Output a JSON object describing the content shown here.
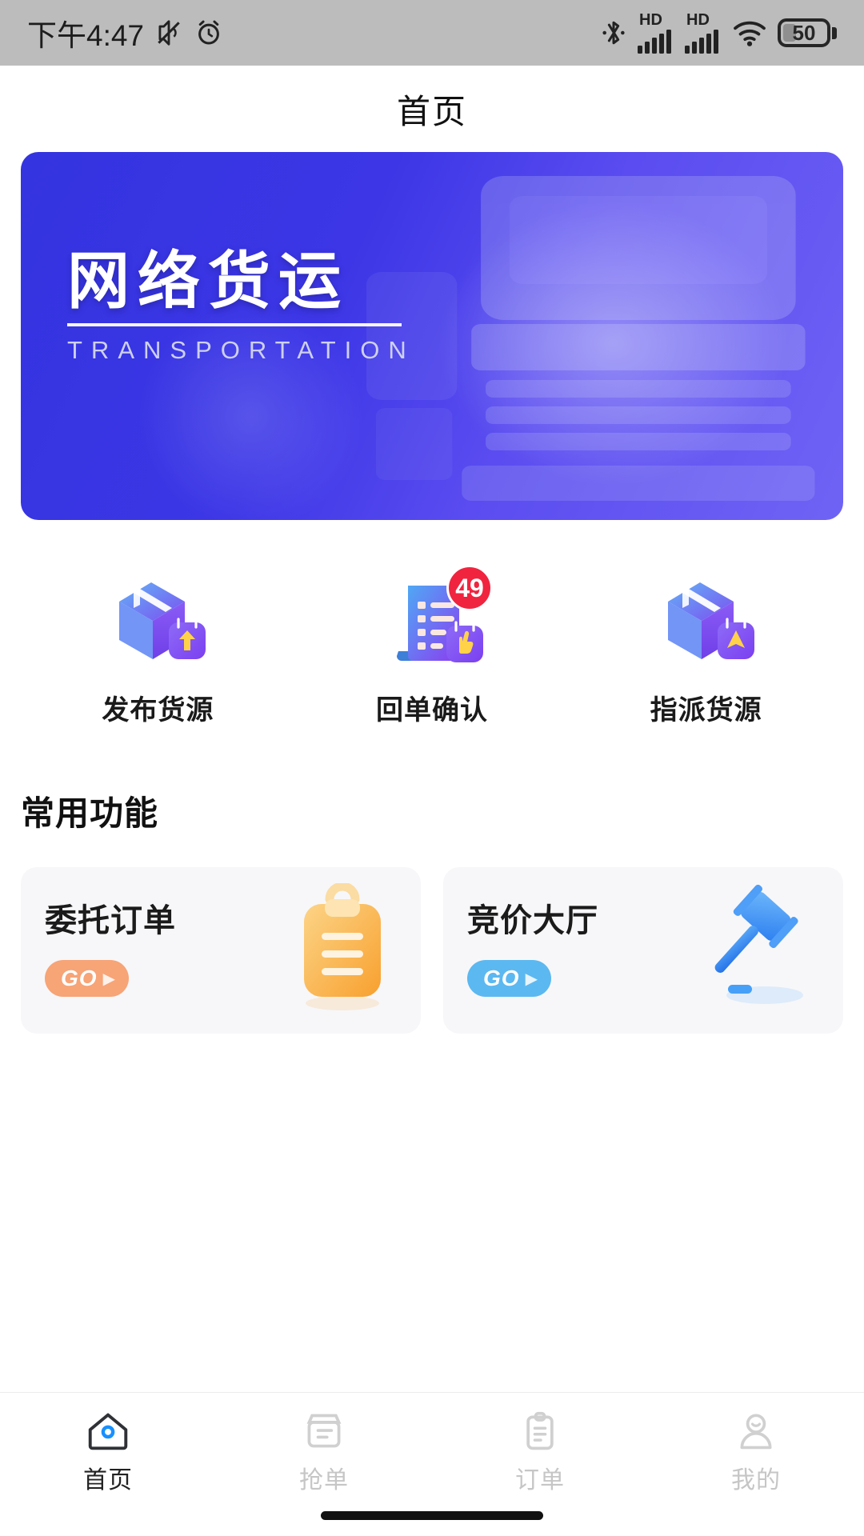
{
  "status_bar": {
    "time": "下午4:47",
    "icons_left": [
      "mute-icon",
      "alarm-icon"
    ],
    "icons_right": [
      "bluetooth-icon",
      "hd-signal-icon-1",
      "hd-signal-icon-2",
      "wifi-icon",
      "battery-icon"
    ],
    "hd_label": "HD",
    "battery_level": "50"
  },
  "header": {
    "title": "首页"
  },
  "banner": {
    "title_cn": "网络货运",
    "title_en": "TRANSPORTATION",
    "gradient_from": "#3434e0",
    "gradient_to": "#6f63f5"
  },
  "quick_actions": [
    {
      "label": "发布货源",
      "icon": "box-upload-icon",
      "badge": ""
    },
    {
      "label": "回单确认",
      "icon": "receipt-confirm-icon",
      "badge": "49"
    },
    {
      "label": "指派货源",
      "icon": "box-assign-icon",
      "badge": ""
    }
  ],
  "common_section": {
    "title": "常用功能",
    "cards": [
      {
        "title": "委托订单",
        "go_label": "GO",
        "go_color": "#f7a477",
        "icon": "clipboard-icon"
      },
      {
        "title": "竞价大厅",
        "go_label": "GO",
        "go_color": "#5cb8f0",
        "icon": "gavel-icon"
      }
    ]
  },
  "tabbar": {
    "items": [
      {
        "label": "首页",
        "icon": "home-icon",
        "active": true
      },
      {
        "label": "抢单",
        "icon": "grab-order-icon",
        "active": false
      },
      {
        "label": "订单",
        "icon": "order-clipboard-icon",
        "active": false
      },
      {
        "label": "我的",
        "icon": "user-icon",
        "active": false
      }
    ]
  },
  "colors": {
    "accent_blue": "#1890ff",
    "badge_red": "#f0243f",
    "inactive_gray": "#c6c6c6",
    "card_bg": "#f7f7f9"
  }
}
